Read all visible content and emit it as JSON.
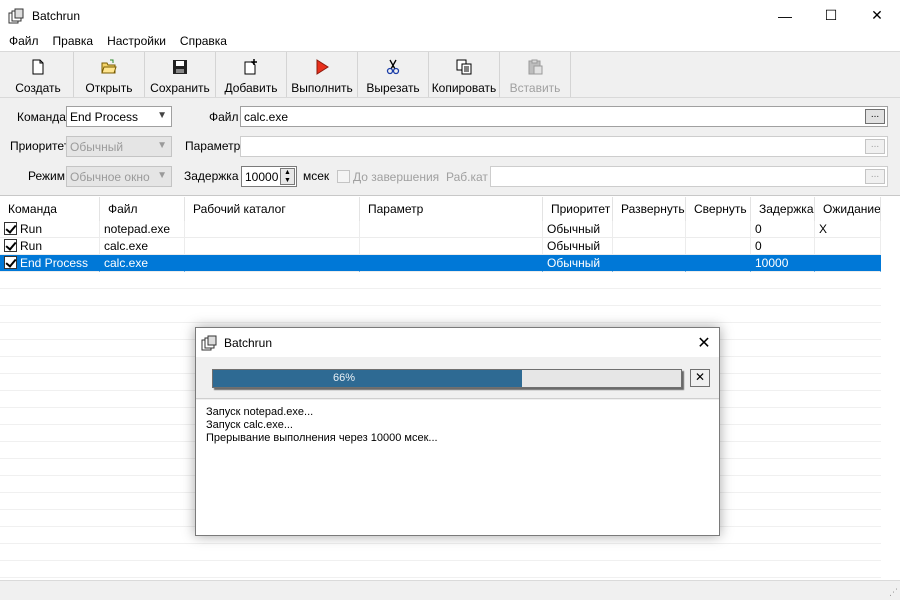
{
  "window": {
    "title": "Batchrun",
    "minimize": "—",
    "maximize": "☐",
    "close": "✕"
  },
  "menu": [
    "Файл",
    "Правка",
    "Настройки",
    "Справка"
  ],
  "toolbar": {
    "create": "Создать",
    "open": "Открыть",
    "save": "Сохранить",
    "add": "Добавить",
    "run": "Выполнить",
    "cut": "Вырезать",
    "copy": "Копировать",
    "paste": "Вставить"
  },
  "form": {
    "command_label": "Команда",
    "command_value": "End Process",
    "file_label": "Файл",
    "file_value": "calc.exe",
    "browse": "...",
    "priority_label": "Приоритет",
    "priority_value": "Обычный",
    "param_label": "Параметр",
    "param_value": "",
    "mode_label": "Режим",
    "mode_value": "Обычное окно",
    "delay_label": "Задержка",
    "delay_value": "10000",
    "delay_unit": "мсек",
    "wait_label": "До завершения",
    "workdir_label": "Раб.кат",
    "workdir_value": ""
  },
  "grid": {
    "columns": [
      "Команда",
      "Файл",
      "Рабочий каталог",
      "Параметр",
      "Приоритет",
      "Развернуть",
      "Свернуть",
      "Задержка",
      "Ожидание"
    ],
    "rows": [
      {
        "command": "Run",
        "file": "notepad.exe",
        "workdir": "",
        "param": "",
        "priority": "Обычный",
        "maximize": "",
        "minimize": "",
        "delay": "0",
        "wait": "X",
        "checked": true,
        "selected": false
      },
      {
        "command": "Run",
        "file": "calc.exe",
        "workdir": "",
        "param": "",
        "priority": "Обычный",
        "maximize": "",
        "minimize": "",
        "delay": "0",
        "wait": "",
        "checked": true,
        "selected": false
      },
      {
        "command": "End Process",
        "file": "calc.exe",
        "workdir": "",
        "param": "",
        "priority": "Обычный",
        "maximize": "",
        "minimize": "",
        "delay": "10000",
        "wait": "",
        "checked": true,
        "selected": true
      }
    ]
  },
  "dialog": {
    "title": "Batchrun",
    "close": "✕",
    "progress_label": "66%",
    "progress": 0.66,
    "stop": "✕",
    "log": [
      "Запуск notepad.exe...",
      "Запуск calc.exe...",
      "Прерывание выполнения через 10000 мсек..."
    ]
  },
  "colors": {
    "selection": "#0078d7",
    "progress": "#2e6a93",
    "toolbar_bg": "#f0f0f0"
  },
  "icons": [
    "app-icon",
    "new-file-icon",
    "open-folder-icon",
    "save-disk-icon",
    "add-item-icon",
    "run-play-icon",
    "cut-scissors-icon",
    "copy-icon",
    "paste-icon"
  ]
}
